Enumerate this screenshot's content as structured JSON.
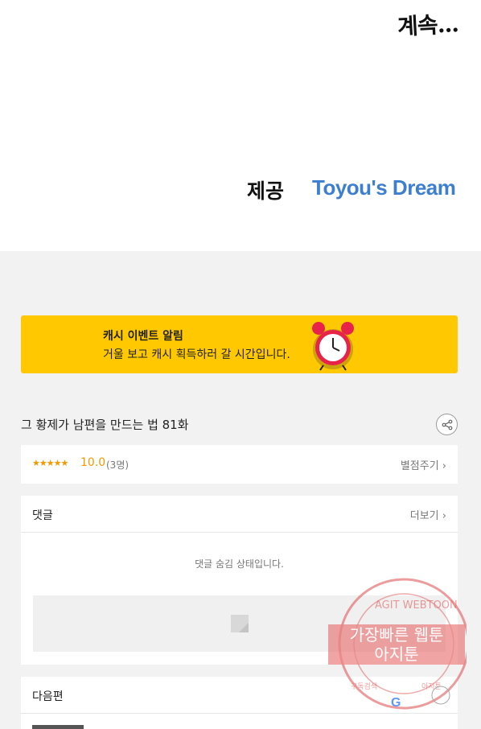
{
  "top": {
    "to_be_continued": "계속...",
    "credit_label": "제공",
    "credit_brand": "Toyou's Dream"
  },
  "banner": {
    "title": "캐시 이벤트 알림",
    "subtitle": "거울 보고 캐시 획득하러 갈 시간입니다.",
    "bg_color": "#ffc800"
  },
  "episode": {
    "title": "그 황제가 남편을 만드는 법 81화",
    "share_icon": "share-icon"
  },
  "rating": {
    "stars": "★★★★★",
    "score": "10.0",
    "count": "(3명)",
    "rate_link": "별점주기",
    "accent_color": "#f39800"
  },
  "comments": {
    "title": "댓글",
    "more": "더보기",
    "hidden_message": "댓글 숨김 상태입니다."
  },
  "next": {
    "title": "다음편"
  },
  "watermark": {
    "arc_text": "AGIT WEBTOON",
    "line1": "가장빠른 웹툰",
    "line2": "아지툰",
    "bottom_left": "구독검색",
    "bottom_right": "아지툰",
    "color": "#e05a5a"
  }
}
